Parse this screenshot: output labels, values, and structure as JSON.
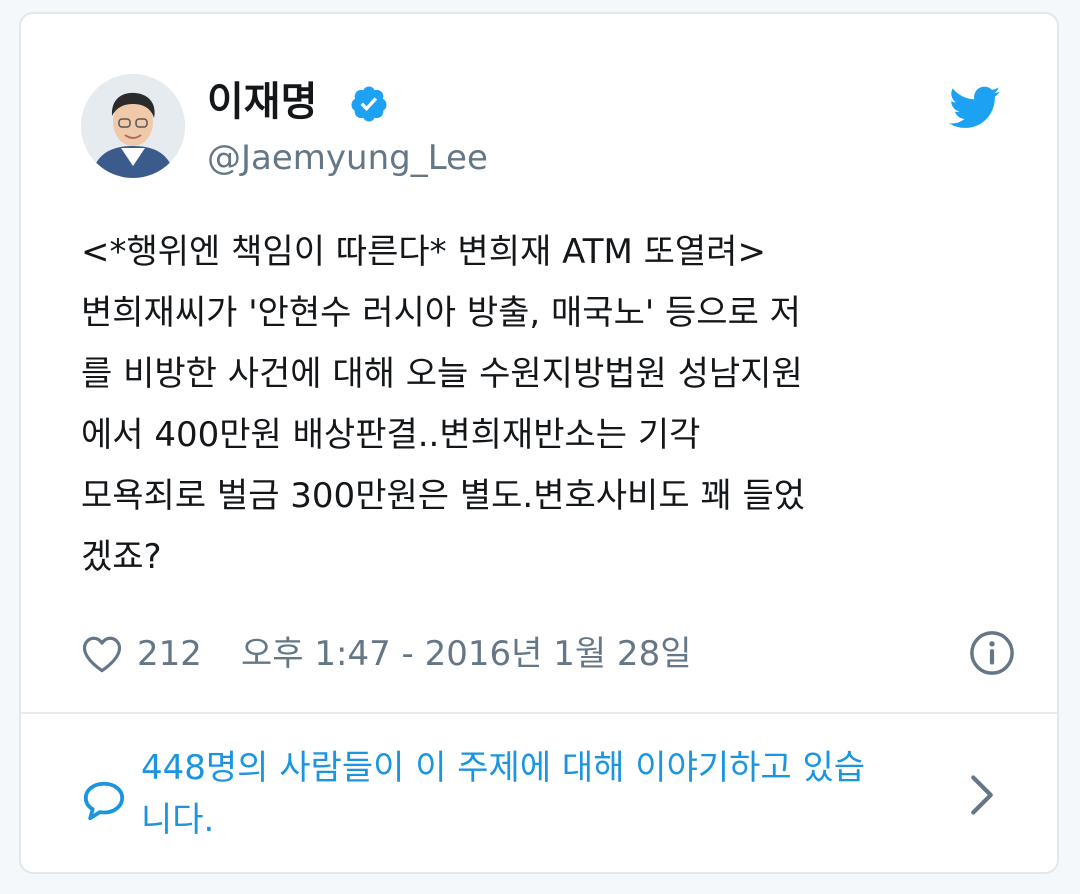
{
  "tweet": {
    "author": {
      "display_name": "이재명",
      "handle": "@Jaemyung_Lee",
      "verified": true
    },
    "text": "<*행위엔 책임이 따른다* 변희재 ATM 또열려>\n변희재씨가 '안현수 러시아 방출, 매국노' 등으로 저\n를 비방한 사건에 대해 오늘 수원지방법원 성남지원\n에서 400만원 배상판결..변희재반소는 기각\n모욕죄로 벌금 300만원은 별도.변호사비도 꽤 들었\n겠죠?",
    "likes": "212",
    "timestamp": "오후 1:47 - 2016년 1월 28일"
  },
  "conversation": {
    "text": "448명의 사람들이 이 주제에 대해 이야기하고 있습\n니다."
  },
  "icons": {
    "verified": "verified-badge-icon",
    "twitter": "twitter-bird-icon",
    "like": "heart-icon",
    "info": "info-icon",
    "conversation": "speech-bubble-icon",
    "chevron": "chevron-right-icon"
  },
  "colors": {
    "twitter_blue": "#1da1f2",
    "link_blue": "#1b95e0",
    "text_primary": "#14171a",
    "text_secondary": "#657786",
    "border": "#e1e8ed"
  }
}
